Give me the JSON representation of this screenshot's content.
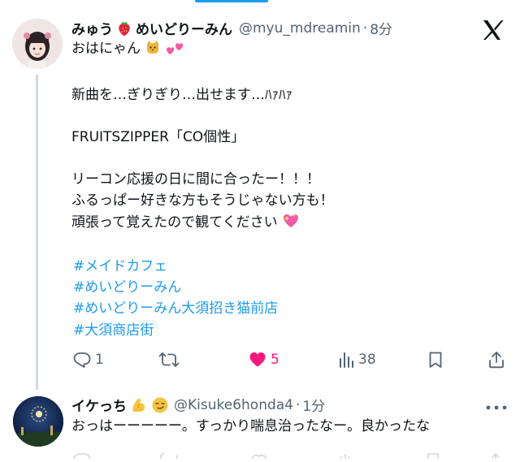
{
  "tweet": {
    "author_name_a": "みゅう",
    "author_name_b": "めいどりーみん",
    "handle": "@myu_mdreamin",
    "dot": "·",
    "time": "8分",
    "line1": "おはにゃん",
    "line2": "新曲を…ぎりぎり…出せます…ﾊｧﾊｧ",
    "line3": "FRUITSZIPPER「CO個性」",
    "line4": "リーコン応援の日に間に合ったー！！！",
    "line5": "ふるっぱー好きな方もそうじゃない方も！",
    "line6": "頑張って覚えたので観てください",
    "hashtags": [
      "#メイドカフェ",
      "#めいどりーみん",
      "#めいどりーみん大須招き猫前店",
      "#大須商店街"
    ],
    "actions": {
      "reply_count": "1",
      "like_count": "5",
      "views_count": "38"
    }
  },
  "reply": {
    "author_name": "イケっち",
    "handle": "@Kisuke6honda4",
    "dot": "·",
    "time": "1分",
    "text": "おっはーーーーー。すっかり喘息治ったなー。良かったな"
  },
  "colors": {
    "accent": "#1d9bf0",
    "like": "#f91880",
    "muted": "#536471",
    "text": "#0f1419"
  }
}
